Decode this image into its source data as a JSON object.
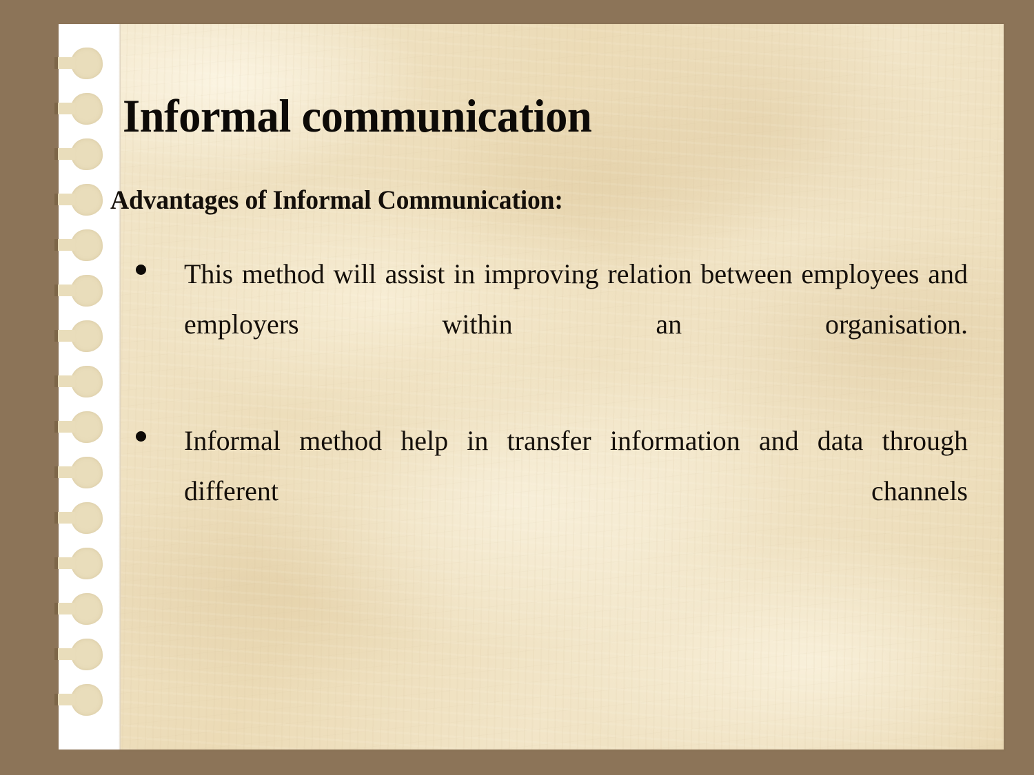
{
  "slide": {
    "title": "Informal communication",
    "subtitle": "Advantages of Informal Communication:",
    "bullets": [
      {
        "marker": "bullet-dot",
        "text": "This method will assist in improving relation between employees and employers within an organisation."
      },
      {
        "marker": "bullet-dot",
        "text": "Informal method help in transfer information and data through different channels"
      }
    ]
  },
  "decoration": {
    "binder": {
      "name": "spiral-binding-strip",
      "hole_count": 15,
      "hole_color": "#e9ddbb",
      "strip_color": "#ffffff"
    },
    "colors": {
      "backdrop": "#8c7458",
      "parchment": "#ecdcb8",
      "text": "#140f0a",
      "title_text": "#0d0a07"
    }
  }
}
